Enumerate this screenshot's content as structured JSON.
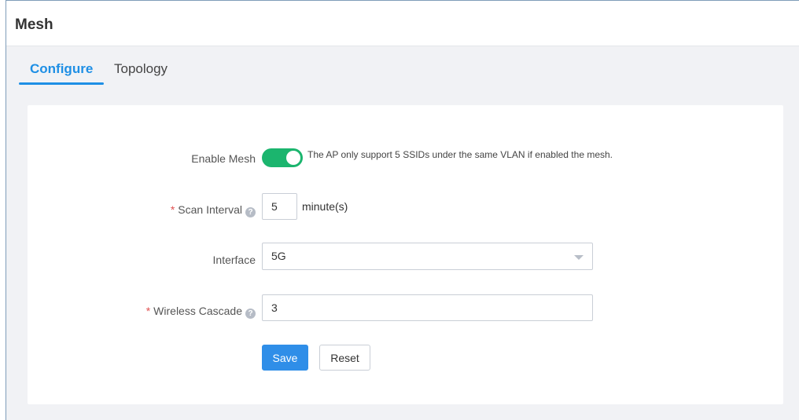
{
  "page": {
    "title": "Mesh"
  },
  "tabs": [
    {
      "label": "Configure",
      "active": true
    },
    {
      "label": "Topology",
      "active": false
    }
  ],
  "form": {
    "enable_mesh": {
      "label": "Enable Mesh",
      "enabled": true,
      "note": "The AP only support 5 SSIDs under the same VLAN if enabled the mesh."
    },
    "scan_interval": {
      "label": "Scan Interval",
      "required_mark": "*",
      "help_icon": "question-circle-icon",
      "value": "5",
      "unit": "minute(s)"
    },
    "interface": {
      "label": "Interface",
      "selected": "5G"
    },
    "wireless_cascade": {
      "label": "Wireless Cascade",
      "required_mark": "*",
      "help_icon": "question-circle-icon",
      "value": "3"
    }
  },
  "buttons": {
    "save": "Save",
    "reset": "Reset"
  },
  "colors": {
    "accent": "#1e8fe5",
    "toggle_on": "#1bb56e",
    "save_button": "#2f8ee8",
    "required": "#e05252"
  }
}
